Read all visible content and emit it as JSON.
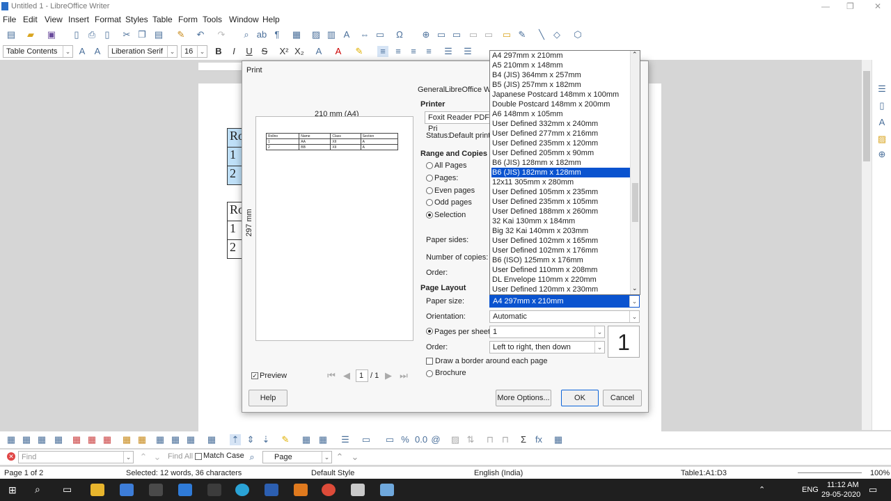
{
  "window": {
    "title": "Untitled 1 - LibreOffice Writer",
    "minimize": "—",
    "restore": "❐",
    "close": "✕"
  },
  "menu": [
    "File",
    "Edit",
    "View",
    "Insert",
    "Format",
    "Styles",
    "Table",
    "Form",
    "Tools",
    "Window",
    "Help"
  ],
  "formatting": {
    "paragraph_style": "Table Contents",
    "font_name": "Liberation Serif",
    "font_size": "16"
  },
  "document": {
    "table1": [
      "Ro",
      "1",
      "2"
    ],
    "table2": [
      "Ro",
      "1",
      "2"
    ]
  },
  "print_dialog": {
    "title": "Print",
    "preview_width_label": "210 mm (A4)",
    "preview_height_label": "297 mm",
    "tabs": [
      "General",
      "LibreOffice Wri"
    ],
    "printer_heading": "Printer",
    "printer_name": "Foxit Reader PDF Pri",
    "status_label": "Status:",
    "status_value": "Default printe",
    "range_heading": "Range and Copies",
    "range_options": [
      "All Pages",
      "Pages:",
      "Even pages",
      "Odd pages",
      "Selection"
    ],
    "paper_sides_label": "Paper sides:",
    "copies_label": "Number of copies:",
    "order_label1": "Order:",
    "page_layout_heading": "Page Layout",
    "paper_size_label": "Paper size:",
    "paper_size_value": "A4 297mm x 210mm",
    "orientation_label": "Orientation:",
    "orientation_value": "Automatic",
    "pages_per_sheet_label": "Pages per sheet:",
    "pages_per_sheet_value": "1",
    "pages_per_sheet_big": "1",
    "order_label2": "Order:",
    "order_value": "Left to right, then down",
    "border_label": "Draw a border around each page",
    "brochure_label": "Brochure",
    "preview_checkbox": "Preview",
    "page_nav_value": "1",
    "page_nav_total": "/ 1",
    "buttons": {
      "help": "Help",
      "more": "More Options...",
      "ok": "OK",
      "cancel": "Cancel"
    },
    "preview_table": {
      "header": [
        "Rollno",
        "Name",
        "Class",
        "Section"
      ],
      "rows": [
        [
          "1",
          "AA",
          "XII",
          "A"
        ],
        [
          "2",
          "BB",
          "XII",
          "A"
        ]
      ]
    }
  },
  "paper_size_list": {
    "selected": "B6 (JIS) 182mm x 128mm",
    "items": [
      "A4 297mm x 210mm",
      "A5 210mm x 148mm",
      "B4 (JIS) 364mm x 257mm",
      "B5 (JIS) 257mm x 182mm",
      "Japanese Postcard 148mm x 100mm",
      "Double Postcard 148mm x 200mm",
      "A6 148mm x 105mm",
      "User Defined 332mm x 240mm",
      "User Defined 277mm x 216mm",
      "User Defined 235mm x 120mm",
      "User Defined 205mm x 90mm",
      "B6 (JIS) 128mm x 182mm",
      "B6 (JIS) 182mm x 128mm",
      "12x11 305mm x 280mm",
      "User Defined 105mm x 235mm",
      "User Defined 235mm x 105mm",
      "User Defined 188mm x 260mm",
      "32 Kai 130mm x 184mm",
      "Big 32 Kai 140mm x 203mm",
      "User Defined 102mm x 165mm",
      "User Defined 102mm x 176mm",
      "B6 (ISO) 125mm x 176mm",
      "User Defined 110mm x 208mm",
      "DL Envelope 110mm x 220mm",
      "User Defined 120mm x 230mm"
    ]
  },
  "findbar": {
    "placeholder": "Find",
    "find_all": "Find All",
    "match_case": "Match Case",
    "search_scope": "Page"
  },
  "statusbar": {
    "page": "Page 1 of 2",
    "selection": "Selected: 12 words, 36 characters",
    "style": "Default Style",
    "language": "English (India)",
    "cell": "Table1:A1:D3",
    "zoom": "100%"
  },
  "taskbar": {
    "lang": "ENG",
    "time": "11:12 AM",
    "date": "29-05-2020"
  }
}
